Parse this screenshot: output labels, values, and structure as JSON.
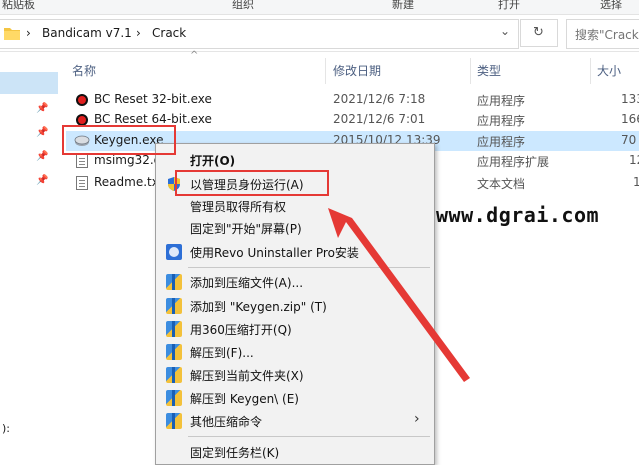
{
  "ribbon": {
    "partial_labels": [
      "粘贴板",
      "组织",
      "新建",
      "打开",
      "选择"
    ]
  },
  "address": {
    "breadcrumb": [
      "Bandicam v7.1",
      "Crack"
    ],
    "separator": "›",
    "dropdown_glyph": "⌄",
    "refresh_glyph": "↻",
    "search_placeholder": "搜索\"Crack\""
  },
  "columns": {
    "name": "名称",
    "modified": "修改日期",
    "type": "类型",
    "size": "大小",
    "sort_glyph": "^"
  },
  "files": [
    {
      "name": "BC Reset 32-bit.exe",
      "modified": "2021/12/6 7:18",
      "type": "应用程序",
      "size": "133",
      "icon": "bandicam-record-icon"
    },
    {
      "name": "BC Reset 64-bit.exe",
      "modified": "2021/12/6 7:01",
      "type": "应用程序",
      "size": "166",
      "icon": "bandicam-record-icon"
    },
    {
      "name": "Keygen.exe",
      "modified": "2015/10/12 13:39",
      "type": "应用程序",
      "size": "70",
      "icon": "keygen-app-icon"
    },
    {
      "name": "msimg32.d",
      "modified": "",
      "type": "应用程序扩展",
      "size": "12",
      "icon": "dll-file-icon"
    },
    {
      "name": "Readme.tx",
      "modified": "",
      "type": "文本文档",
      "size": "1",
      "icon": "text-file-icon"
    }
  ],
  "context_menu": {
    "items": [
      {
        "label": "打开(O)",
        "bold": true,
        "icon": ""
      },
      {
        "label": "以管理员身份运行(A)",
        "icon": "uac-shield-icon"
      },
      {
        "label": "管理员取得所有权",
        "icon": ""
      },
      {
        "label": "固定到\"开始\"屏幕(P)",
        "icon": ""
      },
      {
        "label": "使用Revo Uninstaller Pro安装",
        "icon": "revo-uninstaller-icon"
      },
      {
        "label": "添加到压缩文件(A)...",
        "icon": "winrar-icon"
      },
      {
        "label": "添加到 \"Keygen.zip\" (T)",
        "icon": "winrar-icon"
      },
      {
        "label": "用360压缩打开(Q)",
        "icon": "winrar-icon"
      },
      {
        "label": "解压到(F)...",
        "icon": "winrar-icon"
      },
      {
        "label": "解压到当前文件夹(X)",
        "icon": "winrar-icon"
      },
      {
        "label": "解压到 Keygen\\ (E)",
        "icon": "winrar-icon"
      },
      {
        "label": "其他压缩命令",
        "icon": "winrar-icon",
        "submenu_glyph": "›"
      },
      {
        "label": "固定到任务栏(K)",
        "icon": ""
      }
    ]
  },
  "left_pane": {
    "bottom_text": "):"
  },
  "watermark": "www.dgrai.com",
  "colors": {
    "selection": "#cce8ff",
    "annotation_red": "#e53935",
    "menu_bg": "#f2f2f2"
  }
}
